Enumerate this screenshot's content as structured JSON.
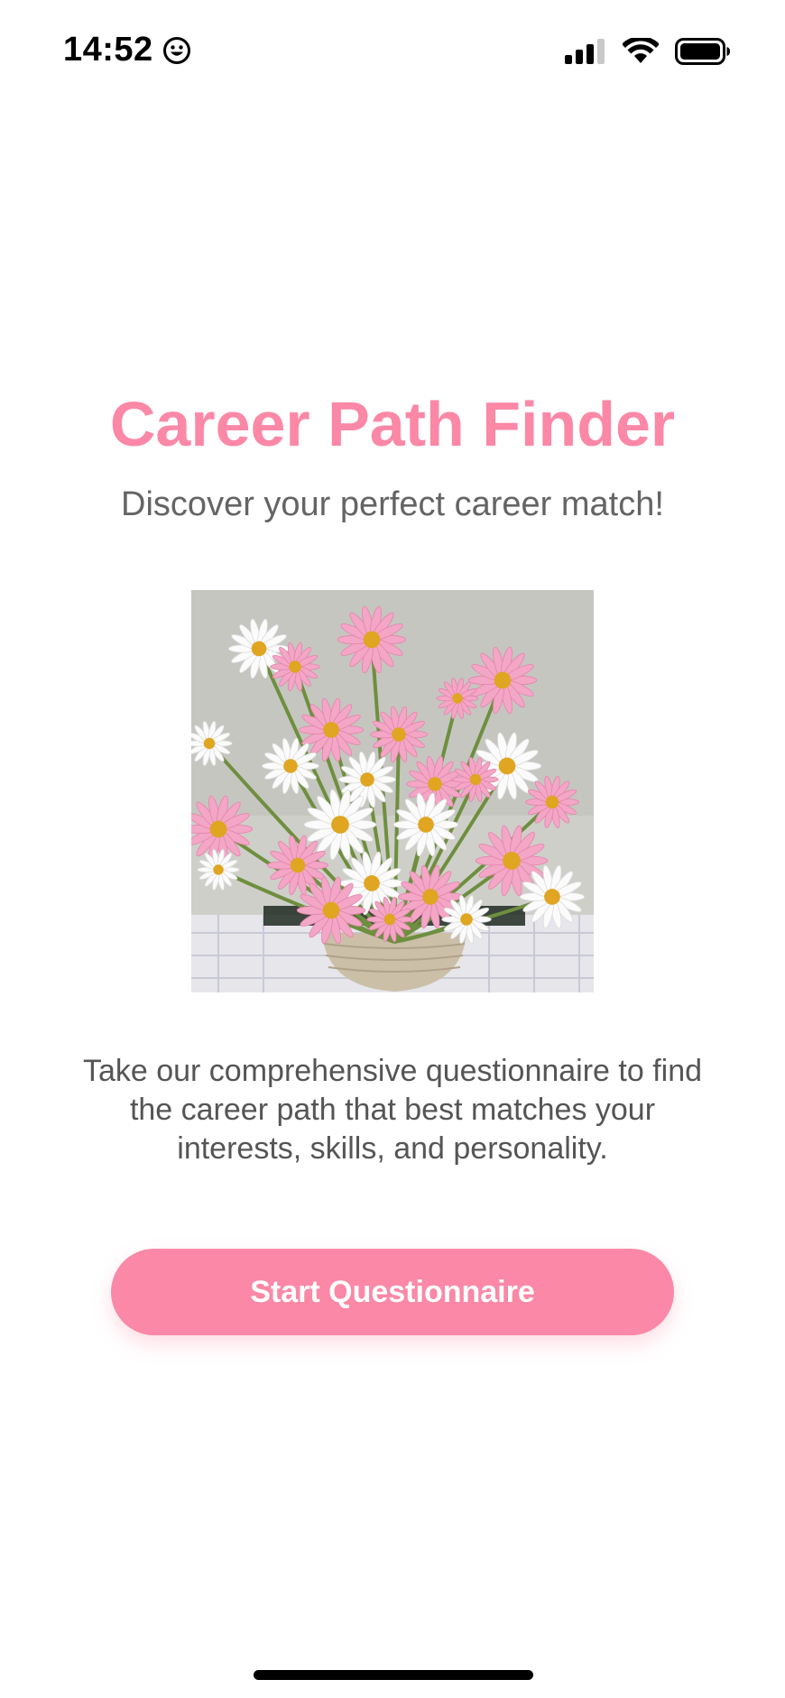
{
  "status_bar": {
    "time": "14:52",
    "icons": [
      "smiley-icon",
      "cellular-signal-icon",
      "wifi-icon",
      "battery-icon"
    ]
  },
  "app": {
    "title": "Career Path Finder",
    "subtitle": "Discover your perfect career match!",
    "image": "pink-and-white-daisy-bouquet",
    "description": "Take our comprehensive questionnaire to find the career path that best matches your interests, skills, and personality.",
    "cta_label": "Start Questionnaire"
  },
  "colors": {
    "accent": "#fb88a6",
    "text_secondary": "#646464",
    "background": "#ffffff"
  }
}
